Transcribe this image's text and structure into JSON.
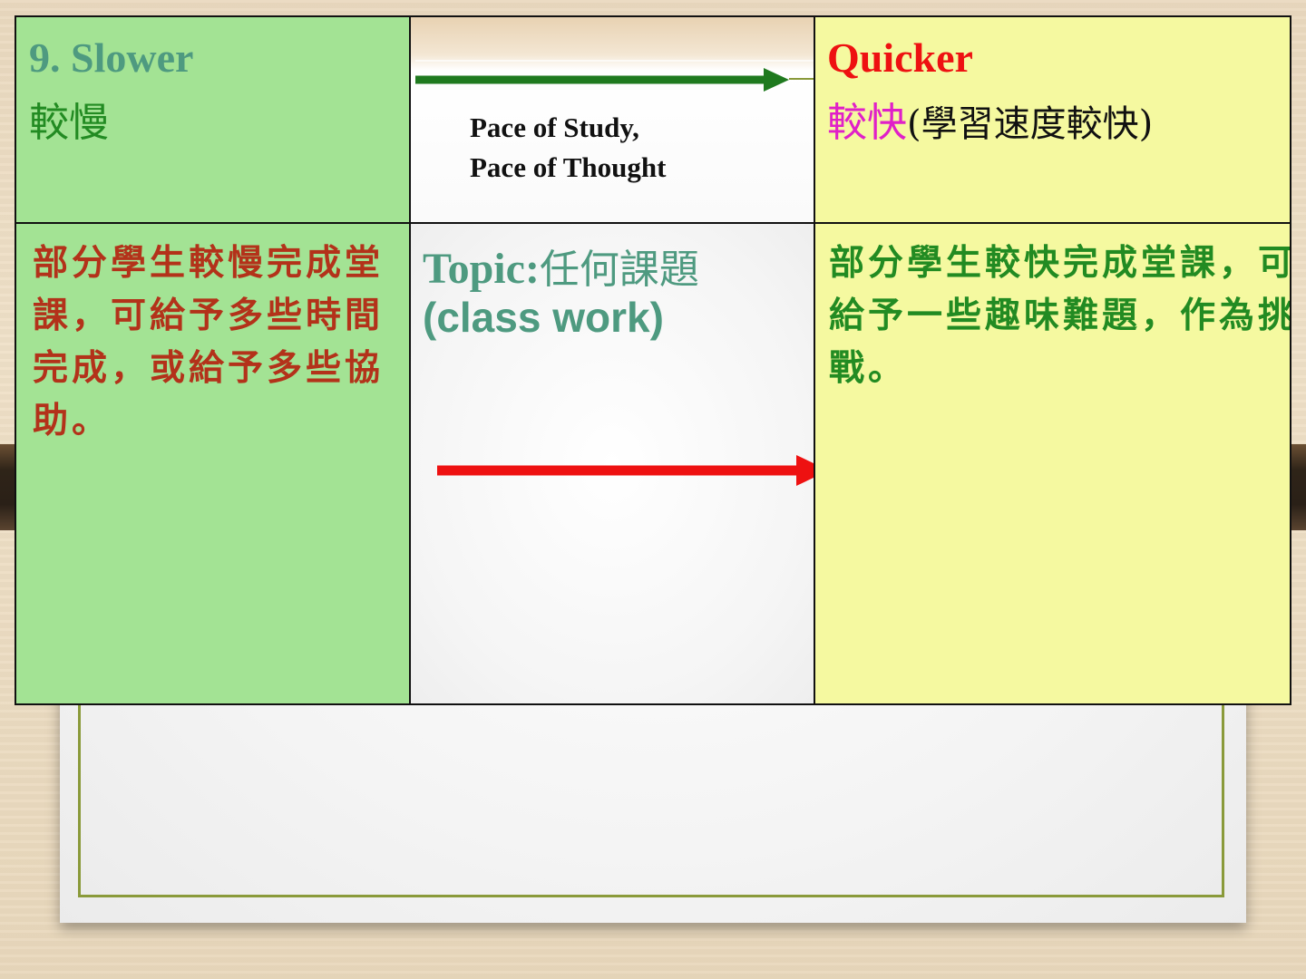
{
  "slide": {
    "colors": {
      "slower_bg": "#a3e394",
      "quicker_bg": "#f5f9a0",
      "teal_text": "#4e9a80",
      "green_text": "#228b22",
      "red_title": "#ee1111",
      "magenta_text": "#e020c8",
      "body_red": "#b3321a",
      "arrow_green": "#1f7a1f",
      "arrow_red": "#ee1111"
    },
    "slower": {
      "title": "9. Slower",
      "subtitle": "較慢",
      "body": "部分學生較慢完成堂課，可給予多些時間完成，或給予多些協助。"
    },
    "middle": {
      "pace_line1": "Pace of Study,",
      "pace_line2": "Pace of Thought",
      "topic_label": "Topic:",
      "topic_zh": "任何課題",
      "topic_sub": "(class work)"
    },
    "quicker": {
      "title": "Quicker",
      "subtitle_zh": "較快",
      "subtitle_paren": "(學習速度較快)",
      "body": "部分學生較快完成堂課，可給予一些趣味難題，作為挑戰。"
    },
    "icons": {
      "top_arrow": "arrow-right-icon",
      "middle_arrow": "arrow-right-icon"
    }
  }
}
